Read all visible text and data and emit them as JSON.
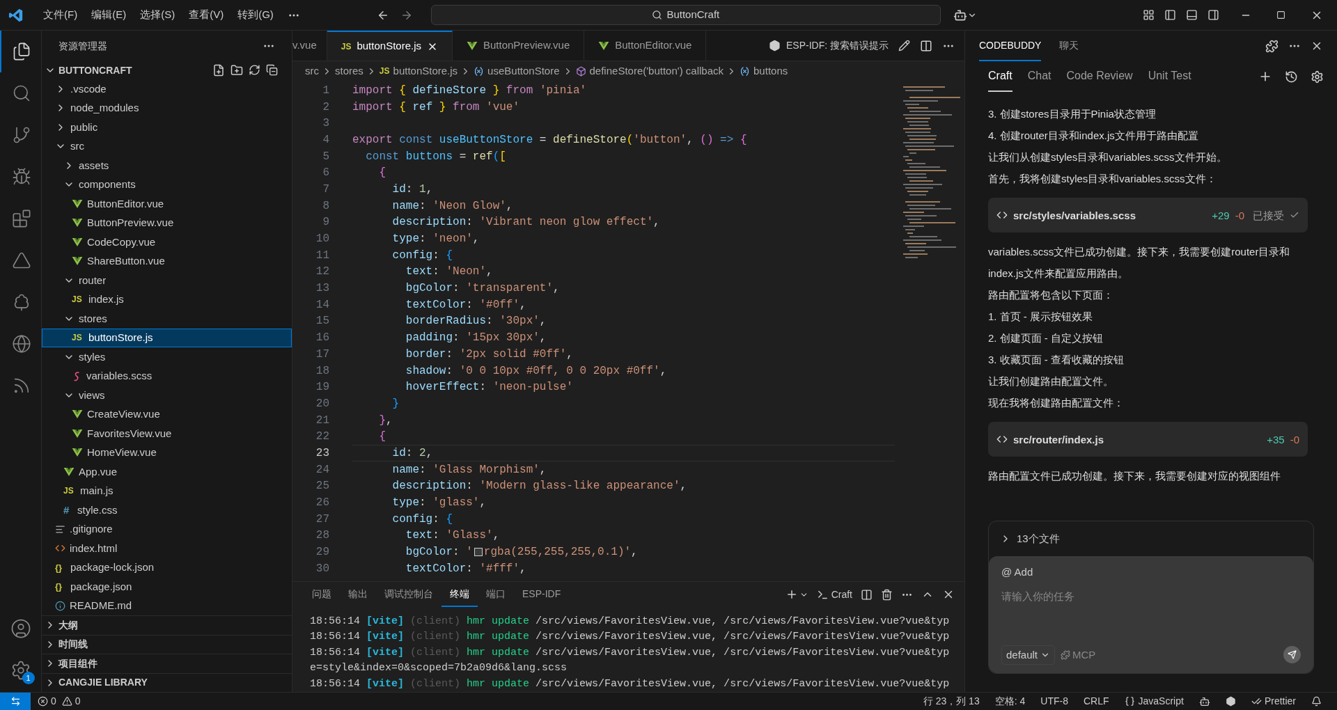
{
  "title_bar": {
    "menu": [
      "文件(F)",
      "编辑(E)",
      "选择(S)",
      "查看(V)",
      "转到(G)"
    ],
    "search": "ButtonCraft"
  },
  "activity_bar": {
    "items": [
      {
        "selected": true
      },
      {
        "selected": false
      },
      {
        "selected": false
      },
      {
        "selected": false
      },
      {
        "selected": false
      },
      {
        "selected": false
      },
      {
        "selected": false
      },
      {
        "selected": false
      },
      {
        "selected": false
      }
    ],
    "settings_badge": "1"
  },
  "explorer": {
    "title": "资源管理器",
    "project": "BUTTONCRAFT",
    "tree": [
      {
        "label": ".vscode",
        "kind": "folder",
        "expanded": false,
        "selected": false
      },
      {
        "label": "node_modules",
        "kind": "folder",
        "expanded": false,
        "selected": false
      },
      {
        "label": "public",
        "kind": "folder",
        "expanded": false,
        "selected": false
      },
      {
        "label": "src",
        "kind": "folder",
        "expanded": true,
        "selected": false,
        "children": [
          {
            "label": "assets",
            "kind": "folder",
            "expanded": false,
            "selected": false
          },
          {
            "label": "components",
            "kind": "folder",
            "expanded": true,
            "selected": false,
            "children": [
              {
                "label": "ButtonEditor.vue",
                "kind": "vue",
                "selected": false
              },
              {
                "label": "ButtonPreview.vue",
                "kind": "vue",
                "selected": false
              },
              {
                "label": "CodeCopy.vue",
                "kind": "vue",
                "selected": false
              },
              {
                "label": "ShareButton.vue",
                "kind": "vue",
                "selected": false
              }
            ]
          },
          {
            "label": "router",
            "kind": "folder",
            "expanded": true,
            "selected": false,
            "children": [
              {
                "label": "index.js",
                "kind": "js",
                "glyph": "JS",
                "selected": false
              }
            ]
          },
          {
            "label": "stores",
            "kind": "folder",
            "expanded": true,
            "selected": false,
            "children": [
              {
                "label": "buttonStore.js",
                "kind": "js",
                "glyph": "JS",
                "selected": true
              }
            ]
          },
          {
            "label": "styles",
            "kind": "folder",
            "expanded": true,
            "selected": false,
            "children": [
              {
                "label": "variables.scss",
                "kind": "scss",
                "selected": false
              }
            ]
          },
          {
            "label": "views",
            "kind": "folder",
            "expanded": true,
            "selected": false,
            "children": [
              {
                "label": "CreateView.vue",
                "kind": "vue",
                "selected": false
              },
              {
                "label": "FavoritesView.vue",
                "kind": "vue",
                "selected": false
              },
              {
                "label": "HomeView.vue",
                "kind": "vue",
                "selected": false
              }
            ]
          },
          {
            "label": "App.vue",
            "kind": "vue",
            "selected": false
          },
          {
            "label": "main.js",
            "kind": "js",
            "glyph": "JS",
            "selected": false
          },
          {
            "label": "style.css",
            "kind": "css",
            "glyph": "#",
            "selected": false
          }
        ]
      },
      {
        "label": ".gitignore",
        "kind": "text",
        "selected": false
      },
      {
        "label": "index.html",
        "kind": "html",
        "selected": false
      },
      {
        "label": "package-lock.json",
        "kind": "json",
        "glyph": "{}",
        "selected": false
      },
      {
        "label": "package.json",
        "kind": "json",
        "glyph": "{}",
        "selected": false
      },
      {
        "label": "README.md",
        "kind": "info",
        "selected": false
      }
    ],
    "sections": [
      {
        "label": "大纲",
        "expanded": false
      },
      {
        "label": "时间线",
        "expanded": false
      },
      {
        "label": "项目组件",
        "expanded": false
      },
      {
        "label": "CANGJIE LIBRARY",
        "expanded": false
      }
    ]
  },
  "editor": {
    "tabs": [
      {
        "label": "v.vue",
        "kind": "partial",
        "selected": false
      },
      {
        "label": "buttonStore.js",
        "kind": "js",
        "glyph": "JS",
        "selected": true
      },
      {
        "label": "ButtonPreview.vue",
        "kind": "vue",
        "selected": false
      },
      {
        "label": "ButtonEditor.vue",
        "kind": "vue",
        "selected": false
      }
    ],
    "action": "ESP-IDF: 搜索错误提示",
    "breadcrumb": [
      {
        "label": "src",
        "kind": "folder"
      },
      {
        "label": "stores",
        "kind": "folder"
      },
      {
        "label": "buttonStore.js",
        "kind": "js",
        "glyph": "JS"
      },
      {
        "label": "useButtonStore",
        "kind": "variable"
      },
      {
        "label": "defineStore('button') callback",
        "kind": "function"
      },
      {
        "label": "buttons",
        "kind": "variable"
      }
    ],
    "lines": [
      {
        "number": "1",
        "current": false,
        "tokens": [
          {
            "kind": "keyword",
            "text": "import "
          },
          {
            "kind": "bracket1",
            "text": "{"
          },
          {
            "kind": "property",
            "text": " defineStore "
          },
          {
            "kind": "bracket1",
            "text": "}"
          },
          {
            "kind": "keyword",
            "text": " from "
          },
          {
            "kind": "string",
            "text": "'pinia'"
          }
        ]
      },
      {
        "number": "2",
        "current": false,
        "tokens": [
          {
            "kind": "keyword",
            "text": "import "
          },
          {
            "kind": "bracket1",
            "text": "{"
          },
          {
            "kind": "property",
            "text": " ref "
          },
          {
            "kind": "bracket1",
            "text": "}"
          },
          {
            "kind": "keyword",
            "text": " from "
          },
          {
            "kind": "string",
            "text": "'vue'"
          }
        ]
      },
      {
        "number": "3",
        "current": false
      },
      {
        "number": "4",
        "current": false,
        "tokens": [
          {
            "kind": "keyword",
            "text": "export "
          },
          {
            "kind": "storage",
            "text": "const "
          },
          {
            "kind": "variable",
            "text": "useButtonStore"
          },
          {
            "kind": "operator",
            "text": " = "
          },
          {
            "kind": "function",
            "text": "defineStore"
          },
          {
            "kind": "bracket1",
            "text": "("
          },
          {
            "kind": "string",
            "text": "'button'"
          },
          {
            "kind": "operator",
            "text": ", "
          },
          {
            "kind": "bracket2",
            "text": "()"
          },
          {
            "kind": "storage",
            "text": " => "
          },
          {
            "kind": "bracket2",
            "text": "{"
          }
        ]
      },
      {
        "number": "5",
        "current": false,
        "tokens": [
          {
            "kind": "storage",
            "text": "  const "
          },
          {
            "kind": "variable",
            "text": "buttons"
          },
          {
            "kind": "operator",
            "text": " = "
          },
          {
            "kind": "function",
            "text": "ref"
          },
          {
            "kind": "bracket3",
            "text": "("
          },
          {
            "kind": "bracket1",
            "text": "["
          }
        ]
      },
      {
        "number": "6",
        "current": false,
        "tokens": [
          {
            "kind": "bracket2",
            "text": "    {"
          }
        ]
      },
      {
        "number": "7",
        "current": false,
        "tokens": [
          {
            "kind": "property",
            "text": "      id"
          },
          {
            "kind": "operator",
            "text": ": "
          },
          {
            "kind": "number",
            "text": "1"
          },
          {
            "kind": "operator",
            "text": ","
          }
        ]
      },
      {
        "number": "8",
        "current": false,
        "tokens": [
          {
            "kind": "property",
            "text": "      name"
          },
          {
            "kind": "operator",
            "text": ": "
          },
          {
            "kind": "string",
            "text": "'Neon Glow'"
          },
          {
            "kind": "operator",
            "text": ","
          }
        ]
      },
      {
        "number": "9",
        "current": false,
        "tokens": [
          {
            "kind": "property",
            "text": "      description"
          },
          {
            "kind": "operator",
            "text": ": "
          },
          {
            "kind": "string",
            "text": "'Vibrant neon glow effect'"
          },
          {
            "kind": "operator",
            "text": ","
          }
        ]
      },
      {
        "number": "10",
        "current": false,
        "tokens": [
          {
            "kind": "property",
            "text": "      type"
          },
          {
            "kind": "operator",
            "text": ": "
          },
          {
            "kind": "string",
            "text": "'neon'"
          },
          {
            "kind": "operator",
            "text": ","
          }
        ]
      },
      {
        "number": "11",
        "current": false,
        "tokens": [
          {
            "kind": "property",
            "text": "      config"
          },
          {
            "kind": "operator",
            "text": ": "
          },
          {
            "kind": "bracket3",
            "text": "{"
          }
        ]
      },
      {
        "number": "12",
        "current": false,
        "tokens": [
          {
            "kind": "property",
            "text": "        text"
          },
          {
            "kind": "operator",
            "text": ": "
          },
          {
            "kind": "string",
            "text": "'Neon'"
          },
          {
            "kind": "operator",
            "text": ","
          }
        ]
      },
      {
        "number": "13",
        "current": false,
        "tokens": [
          {
            "kind": "property",
            "text": "        bgColor"
          },
          {
            "kind": "operator",
            "text": ": "
          },
          {
            "kind": "string",
            "text": "'transparent'"
          },
          {
            "kind": "operator",
            "text": ","
          }
        ]
      },
      {
        "number": "14",
        "current": false,
        "tokens": [
          {
            "kind": "property",
            "text": "        textColor"
          },
          {
            "kind": "operator",
            "text": ": "
          },
          {
            "kind": "string",
            "text": "'#0ff'"
          },
          {
            "kind": "operator",
            "text": ","
          }
        ]
      },
      {
        "number": "15",
        "current": false,
        "tokens": [
          {
            "kind": "property",
            "text": "        borderRadius"
          },
          {
            "kind": "operator",
            "text": ": "
          },
          {
            "kind": "string",
            "text": "'30px'"
          },
          {
            "kind": "operator",
            "text": ","
          }
        ]
      },
      {
        "number": "16",
        "current": false,
        "tokens": [
          {
            "kind": "property",
            "text": "        padding"
          },
          {
            "kind": "operator",
            "text": ": "
          },
          {
            "kind": "string",
            "text": "'15px 30px'"
          },
          {
            "kind": "operator",
            "text": ","
          }
        ]
      },
      {
        "number": "17",
        "current": false,
        "tokens": [
          {
            "kind": "property",
            "text": "        border"
          },
          {
            "kind": "operator",
            "text": ": "
          },
          {
            "kind": "string",
            "text": "'2px solid #0ff'"
          },
          {
            "kind": "operator",
            "text": ","
          }
        ]
      },
      {
        "number": "18",
        "current": false,
        "tokens": [
          {
            "kind": "property",
            "text": "        shadow"
          },
          {
            "kind": "operator",
            "text": ": "
          },
          {
            "kind": "string",
            "text": "'0 0 10px #0ff, 0 0 20px #0ff'"
          },
          {
            "kind": "operator",
            "text": ","
          }
        ]
      },
      {
        "number": "19",
        "current": false,
        "tokens": [
          {
            "kind": "property",
            "text": "        hoverEffect"
          },
          {
            "kind": "operator",
            "text": ": "
          },
          {
            "kind": "string",
            "text": "'neon-pulse'"
          }
        ]
      },
      {
        "number": "20",
        "current": false,
        "tokens": [
          {
            "kind": "bracket3",
            "text": "      }"
          }
        ]
      },
      {
        "number": "21",
        "current": false,
        "tokens": [
          {
            "kind": "bracket2",
            "text": "    }"
          },
          {
            "kind": "operator",
            "text": ","
          }
        ]
      },
      {
        "number": "22",
        "current": false,
        "tokens": [
          {
            "kind": "bracket2",
            "text": "    {"
          }
        ]
      },
      {
        "number": "23",
        "current": true,
        "tokens": [
          {
            "kind": "property",
            "text": "      id"
          },
          {
            "kind": "operator",
            "text": ": "
          },
          {
            "kind": "number",
            "text": "2"
          },
          {
            "kind": "operator",
            "text": ","
          }
        ]
      },
      {
        "number": "24",
        "current": false,
        "tokens": [
          {
            "kind": "property",
            "text": "      name"
          },
          {
            "kind": "operator",
            "text": ": "
          },
          {
            "kind": "string",
            "text": "'Glass Morphism'"
          },
          {
            "kind": "operator",
            "text": ","
          }
        ]
      },
      {
        "number": "25",
        "current": false,
        "tokens": [
          {
            "kind": "property",
            "text": "      description"
          },
          {
            "kind": "operator",
            "text": ": "
          },
          {
            "kind": "string",
            "text": "'Modern glass-like appearance'"
          },
          {
            "kind": "operator",
            "text": ","
          }
        ]
      },
      {
        "number": "26",
        "current": false,
        "tokens": [
          {
            "kind": "property",
            "text": "      type"
          },
          {
            "kind": "operator",
            "text": ": "
          },
          {
            "kind": "string",
            "text": "'glass'"
          },
          {
            "kind": "operator",
            "text": ","
          }
        ]
      },
      {
        "number": "27",
        "current": false,
        "tokens": [
          {
            "kind": "property",
            "text": "      config"
          },
          {
            "kind": "operator",
            "text": ": "
          },
          {
            "kind": "bracket3",
            "text": "{"
          }
        ]
      },
      {
        "number": "28",
        "current": false,
        "tokens": [
          {
            "kind": "property",
            "text": "        text"
          },
          {
            "kind": "operator",
            "text": ": "
          },
          {
            "kind": "string",
            "text": "'Glass'"
          },
          {
            "kind": "operator",
            "text": ","
          }
        ]
      },
      {
        "number": "29",
        "current": false,
        "tokens": [
          {
            "kind": "property",
            "text": "        bgColor"
          },
          {
            "kind": "operator",
            "text": ": "
          },
          {
            "kind": "string",
            "text": "'"
          },
          {
            "kind": "swatch"
          },
          {
            "kind": "string",
            "text": "rgba(255,255,255,0.1)'"
          },
          {
            "kind": "operator",
            "text": ","
          }
        ]
      },
      {
        "number": "30",
        "current": false,
        "tokens": [
          {
            "kind": "property",
            "text": "        textColor"
          },
          {
            "kind": "operator",
            "text": ": "
          },
          {
            "kind": "string",
            "text": "'#fff'"
          },
          {
            "kind": "operator",
            "text": ","
          }
        ]
      }
    ]
  },
  "panel": {
    "tabs": [
      {
        "label": "问题",
        "selected": false
      },
      {
        "label": "输出",
        "selected": false
      },
      {
        "label": "调试控制台",
        "selected": false
      },
      {
        "label": "终端",
        "selected": true
      },
      {
        "label": "端口",
        "selected": false
      },
      {
        "label": "ESP-IDF",
        "selected": false
      }
    ],
    "terminal_name": "Craft",
    "lines": [
      [
        {
          "kind": "time",
          "text": "18:56:14 "
        },
        {
          "kind": "tag",
          "text": "[vite]"
        },
        {
          "kind": "dim",
          "text": " (client)"
        },
        {
          "kind": "success",
          "text": " hmr update"
        },
        {
          "kind": "plain",
          "text": " /src/views/FavoritesView.vue, /src/views/FavoritesView.vue?vue&typ"
        }
      ],
      [
        {
          "kind": "time",
          "text": "18:56:14 "
        },
        {
          "kind": "tag",
          "text": "[vite]"
        },
        {
          "kind": "dim",
          "text": " (client)"
        },
        {
          "kind": "success",
          "text": " hmr update"
        },
        {
          "kind": "plain",
          "text": " /src/views/FavoritesView.vue, /src/views/FavoritesView.vue?vue&typ"
        }
      ],
      [
        {
          "kind": "time",
          "text": "18:56:14 "
        },
        {
          "kind": "tag",
          "text": "[vite]"
        },
        {
          "kind": "dim",
          "text": " (client)"
        },
        {
          "kind": "success",
          "text": " hmr update"
        },
        {
          "kind": "plain",
          "text": " /src/views/FavoritesView.vue, /src/views/FavoritesView.vue?vue&typ"
        }
      ],
      [
        {
          "kind": "plain",
          "text": "e=style&index=0&scoped=7b2a09d6&lang.scss"
        }
      ],
      [
        {
          "kind": "time",
          "text": "18:56:14 "
        },
        {
          "kind": "tag",
          "text": "[vite]"
        },
        {
          "kind": "dim",
          "text": " (client)"
        },
        {
          "kind": "success",
          "text": " hmr update"
        },
        {
          "kind": "plain",
          "text": " /src/views/FavoritesView.vue, /src/views/FavoritesView.vue?vue&typ"
        }
      ]
    ]
  },
  "assistant": {
    "tabs": [
      {
        "label": "CODEBUDDY",
        "selected": true
      },
      {
        "label": "聊天",
        "selected": false
      }
    ],
    "modes": [
      {
        "label": "Craft",
        "selected": true
      },
      {
        "label": "Chat",
        "selected": false
      },
      {
        "label": "Code Review",
        "selected": false
      },
      {
        "label": "Unit Test",
        "selected": false
      }
    ],
    "messages": [
      {
        "kind": "text",
        "text": "3. 创建stores目录用于Pinia状态管理"
      },
      {
        "kind": "text",
        "text": "4. 创建router目录和index.js文件用于路由配置"
      },
      {
        "kind": "text",
        "text": "让我们从创建styles目录和variables.scss文件开始。"
      },
      {
        "kind": "text",
        "text": "首先，我将创建styles目录和variables.scss文件："
      },
      {
        "kind": "file",
        "path": "src/styles/variables.scss",
        "added": "+29",
        "removed": "-0",
        "status": "已接受"
      },
      {
        "kind": "text",
        "text": "variables.scss文件已成功创建。接下来，我需要创建router目录和index.js文件来配置应用路由。"
      },
      {
        "kind": "text",
        "text": "路由配置将包含以下页面："
      },
      {
        "kind": "text",
        "text": "1. 首页 - 展示按钮效果"
      },
      {
        "kind": "text",
        "text": "2. 创建页面 - 自定义按钮"
      },
      {
        "kind": "text",
        "text": "3. 收藏页面 - 查看收藏的按钮"
      },
      {
        "kind": "text",
        "text": "让我们创建路由配置文件。"
      },
      {
        "kind": "text",
        "text": "现在我将创建路由配置文件："
      },
      {
        "kind": "file",
        "path": "src/router/index.js",
        "added": "+35",
        "removed": "-0"
      },
      {
        "kind": "text",
        "text": "路由配置文件已成功创建。接下来，我需要创建对应的视图组件"
      }
    ],
    "files": {
      "label": "13个文件",
      "expanded": false
    },
    "mention": "@ Add",
    "placeholder": "请输入你的任务",
    "model": "default",
    "mcp": "MCP"
  },
  "status_bar": {
    "errors": "0",
    "warnings": "0",
    "items": [
      {
        "kind": "text",
        "label": "行 23，列 13"
      },
      {
        "kind": "text",
        "label": "空格: 4"
      },
      {
        "kind": "text",
        "label": "UTF-8"
      },
      {
        "kind": "text",
        "label": "CRLF"
      },
      {
        "kind": "language",
        "label": "JavaScript"
      },
      {
        "kind": "copilot"
      },
      {
        "kind": "extension"
      },
      {
        "kind": "prettier",
        "label": "Prettier"
      },
      {
        "kind": "bell"
      }
    ]
  }
}
